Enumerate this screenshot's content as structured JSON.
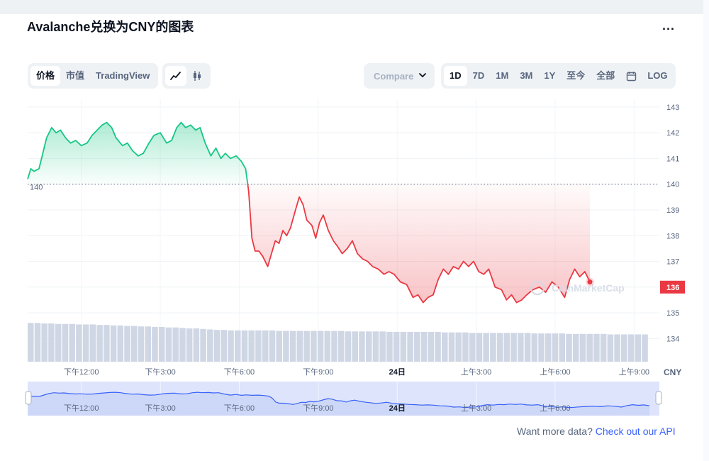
{
  "title": "Avalanche兑换为CNY的图表",
  "menu": {
    "more_label": "..."
  },
  "toolbar": {
    "view_tabs": [
      "价格",
      "市值",
      "TradingView"
    ],
    "active_view": "价格",
    "compare_placeholder": "Compare",
    "range_tabs": [
      "1D",
      "7D",
      "1M",
      "3M",
      "1Y",
      "至今",
      "全部"
    ],
    "active_range": "1D",
    "log_label": "LOG"
  },
  "footer": {
    "prompt": "Want more data?",
    "link": "Check out our API"
  },
  "watermark": "CoinMarketCap",
  "colors": {
    "up": "#16c784",
    "down": "#ea3943",
    "volume": "#cfd6e4",
    "brush": "#dde4fb",
    "brush_line": "#3861fb"
  },
  "chart_data": {
    "type": "area",
    "reference_price": 140,
    "reference_label": "140",
    "current_price": 136,
    "current_label": "136",
    "currency_label": "CNY",
    "y_ticks": [
      143,
      142,
      141,
      140,
      139,
      138,
      137,
      136,
      135,
      134
    ],
    "ylim": [
      133.1,
      143.3
    ],
    "x_ticks": [
      {
        "label": "下午12:00",
        "t": 0.085
      },
      {
        "label": "下午3:00",
        "t": 0.21
      },
      {
        "label": "下午6:00",
        "t": 0.335
      },
      {
        "label": "下午9:00",
        "t": 0.46
      },
      {
        "label": "24日",
        "t": 0.585
      },
      {
        "label": "上午3:00",
        "t": 0.71
      },
      {
        "label": "上午6:00",
        "t": 0.835
      },
      {
        "label": "上午9:00",
        "t": 0.96
      }
    ],
    "brush_ticks": [
      {
        "label": "下午12:00",
        "t": 0.085
      },
      {
        "label": "下午3:00",
        "t": 0.21
      },
      {
        "label": "下午6:00",
        "t": 0.335
      },
      {
        "label": "下午9:00",
        "t": 0.46
      },
      {
        "label": "24日",
        "t": 0.585
      },
      {
        "label": "上午3:00",
        "t": 0.71
      },
      {
        "label": "上午6:00",
        "t": 0.835
      }
    ],
    "price_series": [
      [
        0.0,
        140.2
      ],
      [
        0.005,
        140.6
      ],
      [
        0.01,
        140.5
      ],
      [
        0.018,
        140.6
      ],
      [
        0.025,
        141.3
      ],
      [
        0.03,
        141.8
      ],
      [
        0.038,
        142.2
      ],
      [
        0.045,
        142.0
      ],
      [
        0.052,
        142.1
      ],
      [
        0.06,
        141.8
      ],
      [
        0.068,
        141.6
      ],
      [
        0.076,
        141.7
      ],
      [
        0.085,
        141.5
      ],
      [
        0.094,
        141.6
      ],
      [
        0.102,
        141.9
      ],
      [
        0.11,
        142.1
      ],
      [
        0.118,
        142.3
      ],
      [
        0.125,
        142.4
      ],
      [
        0.133,
        142.2
      ],
      [
        0.14,
        141.8
      ],
      [
        0.15,
        141.5
      ],
      [
        0.158,
        141.6
      ],
      [
        0.166,
        141.3
      ],
      [
        0.175,
        141.1
      ],
      [
        0.183,
        141.2
      ],
      [
        0.192,
        141.6
      ],
      [
        0.2,
        141.9
      ],
      [
        0.21,
        142.0
      ],
      [
        0.22,
        141.6
      ],
      [
        0.228,
        141.7
      ],
      [
        0.236,
        142.2
      ],
      [
        0.243,
        142.4
      ],
      [
        0.25,
        142.2
      ],
      [
        0.258,
        142.3
      ],
      [
        0.266,
        142.1
      ],
      [
        0.273,
        142.2
      ],
      [
        0.281,
        141.6
      ],
      [
        0.29,
        141.1
      ],
      [
        0.298,
        141.4
      ],
      [
        0.306,
        141.0
      ],
      [
        0.313,
        141.2
      ],
      [
        0.321,
        141.0
      ],
      [
        0.33,
        141.1
      ],
      [
        0.338,
        140.9
      ],
      [
        0.345,
        140.6
      ],
      [
        0.35,
        139.7
      ],
      [
        0.355,
        137.9
      ],
      [
        0.36,
        137.4
      ],
      [
        0.366,
        137.4
      ],
      [
        0.372,
        137.2
      ],
      [
        0.38,
        136.8
      ],
      [
        0.386,
        137.3
      ],
      [
        0.392,
        137.8
      ],
      [
        0.398,
        137.7
      ],
      [
        0.404,
        138.2
      ],
      [
        0.41,
        138.0
      ],
      [
        0.416,
        138.3
      ],
      [
        0.424,
        139.0
      ],
      [
        0.43,
        139.5
      ],
      [
        0.436,
        139.2
      ],
      [
        0.442,
        138.6
      ],
      [
        0.45,
        138.4
      ],
      [
        0.456,
        137.9
      ],
      [
        0.462,
        138.5
      ],
      [
        0.468,
        138.8
      ],
      [
        0.476,
        138.2
      ],
      [
        0.484,
        137.8
      ],
      [
        0.49,
        137.6
      ],
      [
        0.498,
        137.3
      ],
      [
        0.506,
        137.5
      ],
      [
        0.514,
        137.8
      ],
      [
        0.522,
        137.3
      ],
      [
        0.53,
        137.1
      ],
      [
        0.538,
        137.0
      ],
      [
        0.546,
        136.8
      ],
      [
        0.555,
        136.7
      ],
      [
        0.564,
        136.5
      ],
      [
        0.572,
        136.6
      ],
      [
        0.58,
        136.5
      ],
      [
        0.59,
        136.2
      ],
      [
        0.6,
        136.1
      ],
      [
        0.61,
        135.6
      ],
      [
        0.618,
        135.7
      ],
      [
        0.626,
        135.4
      ],
      [
        0.634,
        135.6
      ],
      [
        0.642,
        135.7
      ],
      [
        0.65,
        136.3
      ],
      [
        0.658,
        136.7
      ],
      [
        0.666,
        136.5
      ],
      [
        0.674,
        136.8
      ],
      [
        0.682,
        136.7
      ],
      [
        0.69,
        137.0
      ],
      [
        0.698,
        136.8
      ],
      [
        0.706,
        137.0
      ],
      [
        0.714,
        136.6
      ],
      [
        0.722,
        136.5
      ],
      [
        0.73,
        136.7
      ],
      [
        0.74,
        136.0
      ],
      [
        0.75,
        135.9
      ],
      [
        0.758,
        135.5
      ],
      [
        0.766,
        135.7
      ],
      [
        0.774,
        135.4
      ],
      [
        0.782,
        135.5
      ],
      [
        0.79,
        135.7
      ],
      [
        0.8,
        135.9
      ],
      [
        0.81,
        136.0
      ],
      [
        0.82,
        135.8
      ],
      [
        0.83,
        136.2
      ],
      [
        0.84,
        136.0
      ],
      [
        0.85,
        135.6
      ],
      [
        0.858,
        136.3
      ],
      [
        0.866,
        136.7
      ],
      [
        0.874,
        136.4
      ],
      [
        0.882,
        136.6
      ],
      [
        0.89,
        136.2
      ]
    ],
    "volume_series": [
      0.78,
      0.78,
      0.77,
      0.77,
      0.76,
      0.76,
      0.76,
      0.75,
      0.75,
      0.75,
      0.74,
      0.74,
      0.73,
      0.73,
      0.72,
      0.72,
      0.71,
      0.71,
      0.7,
      0.7,
      0.69,
      0.69,
      0.68,
      0.67,
      0.67,
      0.66,
      0.65,
      0.64,
      0.64,
      0.63,
      0.63,
      0.63,
      0.63,
      0.63,
      0.63,
      0.63,
      0.62,
      0.62,
      0.62,
      0.62,
      0.62,
      0.62,
      0.62,
      0.62,
      0.62,
      0.62,
      0.61,
      0.61,
      0.61,
      0.61,
      0.61,
      0.61,
      0.6,
      0.6,
      0.6,
      0.6,
      0.6,
      0.6,
      0.6,
      0.6,
      0.59,
      0.59,
      0.59,
      0.59,
      0.58,
      0.58,
      0.58,
      0.58,
      0.58,
      0.58,
      0.58,
      0.58,
      0.58,
      0.57,
      0.57,
      0.57,
      0.57,
      0.57,
      0.56,
      0.56,
      0.56,
      0.56,
      0.56,
      0.56,
      0.55,
      0.55,
      0.55,
      0.55,
      0.55,
      0.55
    ]
  }
}
